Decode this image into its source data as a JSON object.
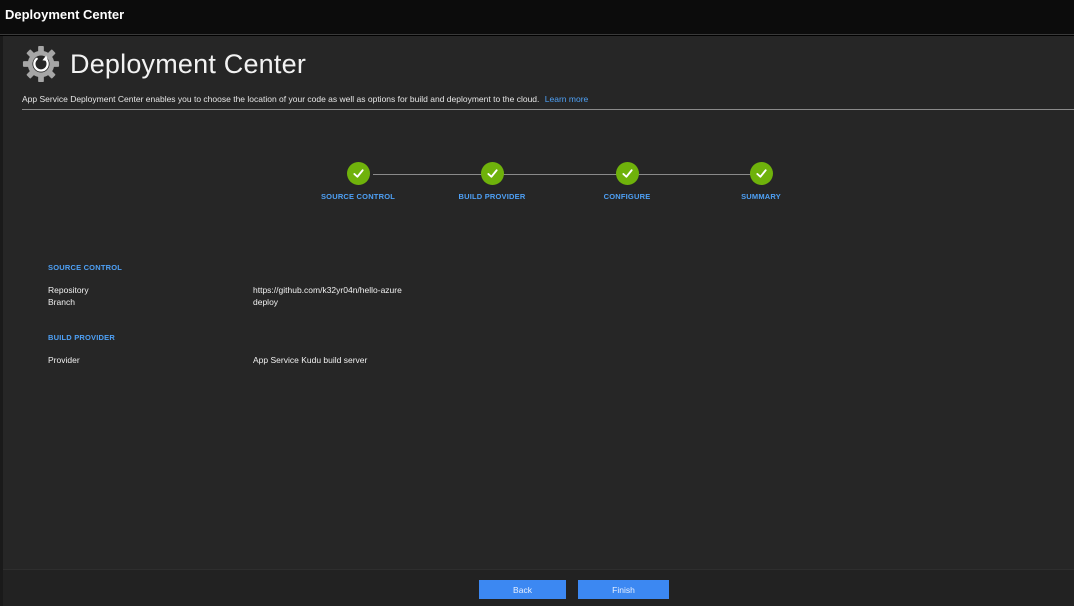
{
  "window": {
    "title": "Deployment Center"
  },
  "header": {
    "title": "Deployment Center",
    "icon": "gear-icon",
    "description": "App Service Deployment Center enables you to choose the location of your code as well as options for build and deployment to the cloud.",
    "learn_more": "Learn more"
  },
  "steps": [
    {
      "label": "SOURCE CONTROL",
      "status": "complete"
    },
    {
      "label": "BUILD PROVIDER",
      "status": "complete"
    },
    {
      "label": "CONFIGURE",
      "status": "complete"
    },
    {
      "label": "SUMMARY",
      "status": "complete"
    }
  ],
  "summary": {
    "source_control": {
      "title": "SOURCE CONTROL",
      "repository_label": "Repository",
      "repository_value": "https://github.com/k32yr04n/hello-azure",
      "branch_label": "Branch",
      "branch_value": "deploy"
    },
    "build_provider": {
      "title": "BUILD PROVIDER",
      "provider_label": "Provider",
      "provider_value": "App Service Kudu build server"
    }
  },
  "footer": {
    "back_label": "Back",
    "finish_label": "Finish"
  },
  "colors": {
    "accent": "#3c88f2",
    "link": "#4ea0f5",
    "success": "#6fb20b",
    "panel": "#262626"
  }
}
